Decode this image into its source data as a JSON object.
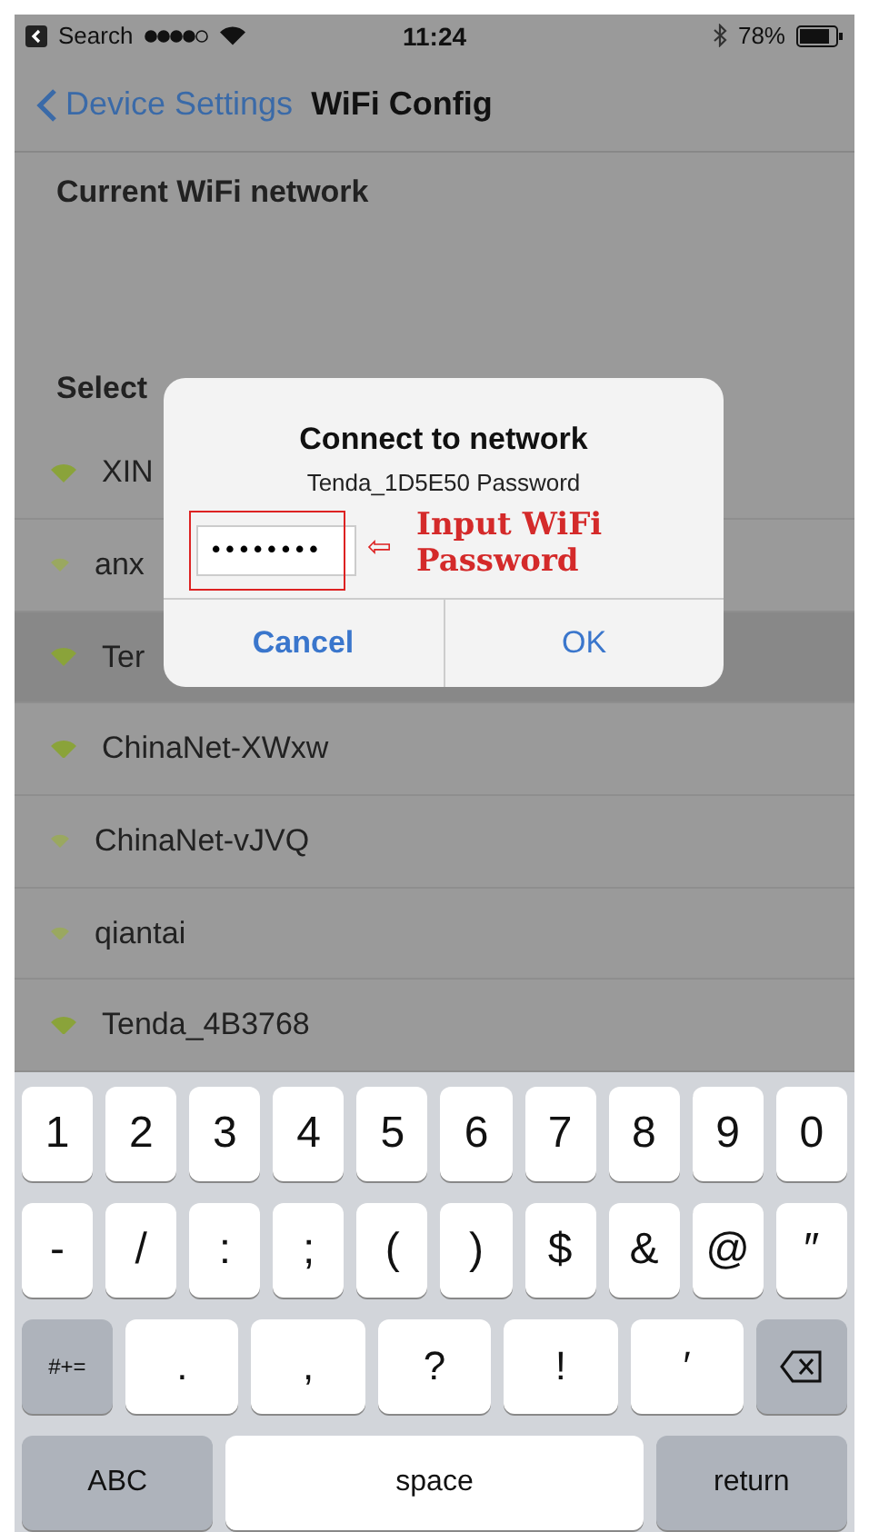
{
  "status_bar": {
    "back_label": "Search",
    "time": "11:24",
    "battery": "78%"
  },
  "nav": {
    "back": "Device Settings",
    "title": "WiFi Config"
  },
  "current_section": {
    "title": "Current WiFi network"
  },
  "select_section": {
    "title": "Select"
  },
  "networks": [
    {
      "name": "XIN",
      "kind": "strong",
      "selected": false
    },
    {
      "name": "anx",
      "kind": "weak",
      "selected": false
    },
    {
      "name": "Ter",
      "kind": "strong",
      "selected": true
    },
    {
      "name": "ChinaNet-XWxw",
      "kind": "strong",
      "selected": false
    },
    {
      "name": "ChinaNet-vJVQ",
      "kind": "weak",
      "selected": false
    },
    {
      "name": "qiantai",
      "kind": "weak",
      "selected": false
    },
    {
      "name": "Tenda_4B3768",
      "kind": "strong",
      "selected": false
    }
  ],
  "dialog": {
    "title": "Connect to network",
    "message": "Tenda_1D5E50 Password",
    "password": "••••••••",
    "buttons": [
      "Cancel",
      "OK"
    ]
  },
  "annotation": {
    "arrow": "⇦",
    "text": "Input WiFi Password"
  },
  "keyboard": {
    "number_keys": [
      {
        "label": "1",
        "kind": "char"
      },
      {
        "label": "2",
        "kind": "char"
      },
      {
        "label": "3",
        "kind": "char"
      },
      {
        "label": "4",
        "kind": "char"
      },
      {
        "label": "5",
        "kind": "char"
      },
      {
        "label": "6",
        "kind": "char"
      },
      {
        "label": "7",
        "kind": "char"
      },
      {
        "label": "8",
        "kind": "char"
      },
      {
        "label": "9",
        "kind": "char"
      },
      {
        "label": "0",
        "kind": "char"
      }
    ],
    "symbol_keys": [
      {
        "label": "-",
        "kind": "char"
      },
      {
        "label": "/",
        "kind": "char"
      },
      {
        "label": ":",
        "kind": "char"
      },
      {
        "label": ";",
        "kind": "char"
      },
      {
        "label": "(",
        "kind": "char"
      },
      {
        "label": ")",
        "kind": "char"
      },
      {
        "label": "$",
        "kind": "char"
      },
      {
        "label": "&",
        "kind": "char"
      },
      {
        "label": "@",
        "kind": "char"
      },
      {
        "label": "″",
        "kind": "char"
      }
    ],
    "punctuation_keys": [
      {
        "label": "#+=",
        "kind": "mode"
      },
      {
        "label": ".",
        "kind": "wide"
      },
      {
        "label": ",",
        "kind": "wide"
      },
      {
        "label": "?",
        "kind": "wide"
      },
      {
        "label": "!",
        "kind": "wide"
      },
      {
        "label": "′",
        "kind": "wide"
      },
      {
        "kind": "delete"
      }
    ],
    "bottom_keys": [
      {
        "label": "ABC",
        "kind": "bottom"
      },
      {
        "label": "space",
        "kind": "space"
      },
      {
        "label": "return",
        "kind": "bottom"
      }
    ]
  }
}
